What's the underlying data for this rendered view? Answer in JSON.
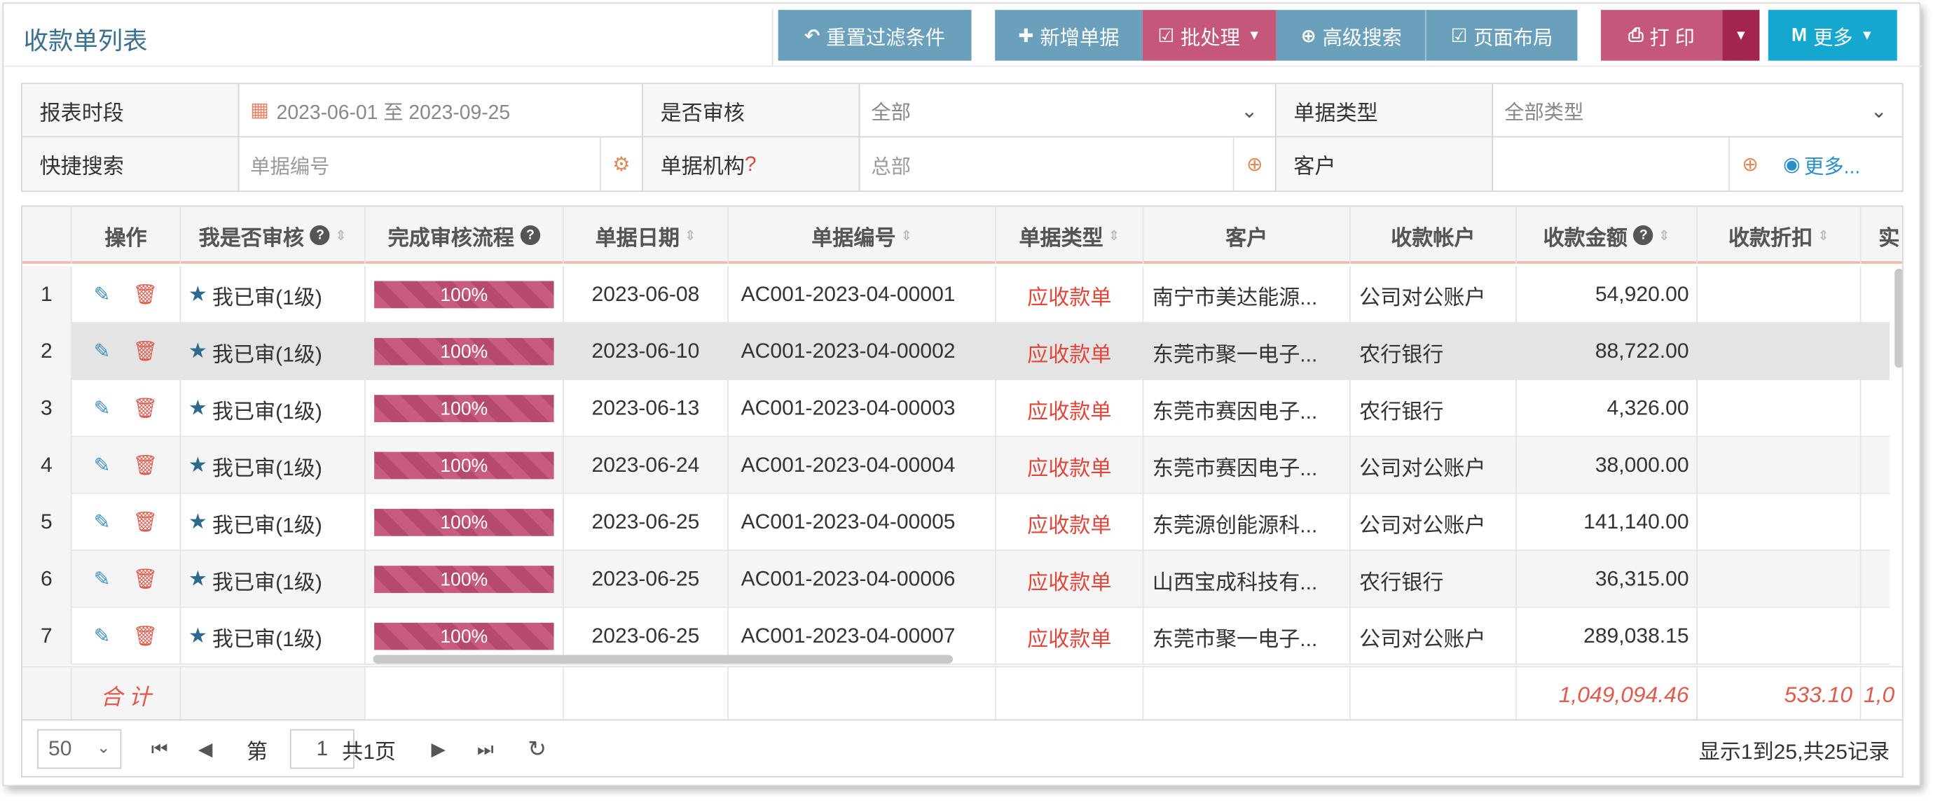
{
  "header": {
    "title": "收款单列表",
    "buttons": {
      "reset": "重置过滤条件",
      "add": "新增单据",
      "batch": "批处理",
      "advanced": "高级搜索",
      "layout": "页面布局",
      "print": "打 印",
      "more": "更多"
    }
  },
  "filters": {
    "period_label": "报表时段",
    "period_value": "2023-06-01 至 2023-09-25",
    "audited_label": "是否审核",
    "audited_value": "全部",
    "type_label": "单据类型",
    "type_value": "全部类型",
    "quick_label": "快捷搜索",
    "quick_placeholder": "单据编号",
    "org_label": "单据机构",
    "org_mark": "?",
    "org_value": "总部",
    "customer_label": "客户",
    "more_link": "更多..."
  },
  "grid": {
    "columns": {
      "ops": "操作",
      "my_audit": "我是否审核",
      "flow": "完成审核流程",
      "date": "单据日期",
      "code": "单据编号",
      "type": "单据类型",
      "customer": "客户",
      "account": "收款帐户",
      "amount": "收款金额",
      "discount": "收款折扣",
      "actual": "实"
    },
    "rows": [
      {
        "n": "1",
        "audit": "我已审(1级)",
        "flow": "100%",
        "date": "2023-06-08",
        "code": "AC001-2023-04-00001",
        "type": "应收款单",
        "customer": "南宁市美达能源...",
        "account": "公司对公账户",
        "amount": "54,920.00"
      },
      {
        "n": "2",
        "audit": "我已审(1级)",
        "flow": "100%",
        "date": "2023-06-10",
        "code": "AC001-2023-04-00002",
        "type": "应收款单",
        "customer": "东莞市聚一电子...",
        "account": "农行银行",
        "amount": "88,722.00"
      },
      {
        "n": "3",
        "audit": "我已审(1级)",
        "flow": "100%",
        "date": "2023-06-13",
        "code": "AC001-2023-04-00003",
        "type": "应收款单",
        "customer": "东莞市赛因电子...",
        "account": "农行银行",
        "amount": "4,326.00"
      },
      {
        "n": "4",
        "audit": "我已审(1级)",
        "flow": "100%",
        "date": "2023-06-24",
        "code": "AC001-2023-04-00004",
        "type": "应收款单",
        "customer": "东莞市赛因电子...",
        "account": "公司对公账户",
        "amount": "38,000.00"
      },
      {
        "n": "5",
        "audit": "我已审(1级)",
        "flow": "100%",
        "date": "2023-06-25",
        "code": "AC001-2023-04-00005",
        "type": "应收款单",
        "customer": "东莞源创能源科...",
        "account": "公司对公账户",
        "amount": "141,140.00"
      },
      {
        "n": "6",
        "audit": "我已审(1级)",
        "flow": "100%",
        "date": "2023-06-25",
        "code": "AC001-2023-04-00006",
        "type": "应收款单",
        "customer": "山西宝成科技有...",
        "account": "农行银行",
        "amount": "36,315.00"
      },
      {
        "n": "7",
        "audit": "我已审(1级)",
        "flow": "100%",
        "date": "2023-06-25",
        "code": "AC001-2023-04-00007",
        "type": "应收款单",
        "customer": "东莞市聚一电子...",
        "account": "公司对公账户",
        "amount": "289,038.15"
      }
    ],
    "total": {
      "label": "合 计",
      "amount": "1,049,094.46",
      "discount": "533.10",
      "actual": "1,0"
    }
  },
  "pager": {
    "page_size": "50",
    "page_prefix": "第",
    "page": "1",
    "page_total": "共1页",
    "info": "显示1到25,共25记录"
  }
}
